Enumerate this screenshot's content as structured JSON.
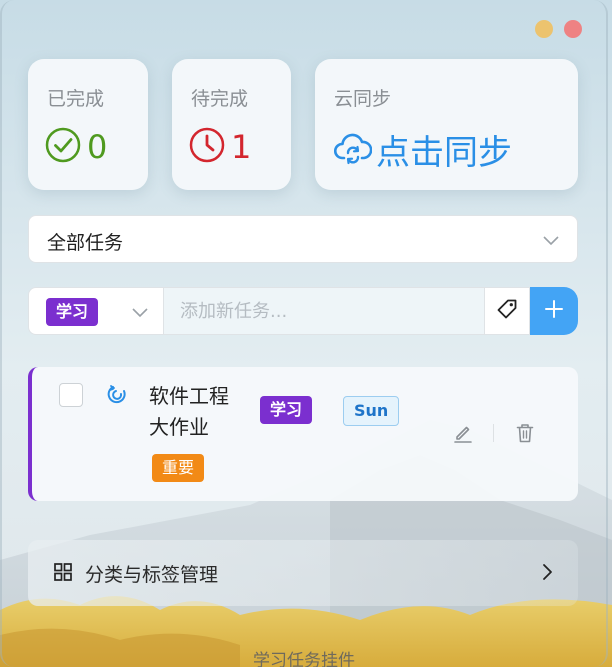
{
  "window": {
    "controls": [
      "minimize",
      "close"
    ],
    "colors": {
      "minimize": "#ecc36e",
      "close": "#ee8283"
    }
  },
  "stats": {
    "completed": {
      "label": "已完成",
      "value": "0",
      "icon": "check-circle-icon",
      "color": "#4f9a1f"
    },
    "pending": {
      "label": "待完成",
      "value": "1",
      "icon": "clock-icon",
      "color": "#d3262e"
    },
    "sync": {
      "label": "云同步",
      "action": "点击同步",
      "icon": "cloud-sync-icon",
      "color": "#2a8fe6"
    }
  },
  "filter": {
    "selected": "全部任务"
  },
  "new_task": {
    "category": "学习",
    "placeholder": "添加新任务...",
    "tag_icon": "tag-icon",
    "add_icon": "plus-icon"
  },
  "tasks": [
    {
      "title": "软件工程大作业",
      "title_lines": [
        "软件工程",
        "大作业"
      ],
      "done": false,
      "icon": "swirl-icon",
      "category": "学习",
      "due": "Sun",
      "priority": "重要",
      "accent": "#7b2fcf"
    }
  ],
  "manage": {
    "label": "分类与标签管理",
    "icon": "grid-icon"
  },
  "footer": {
    "title": "学习任务挂件"
  }
}
